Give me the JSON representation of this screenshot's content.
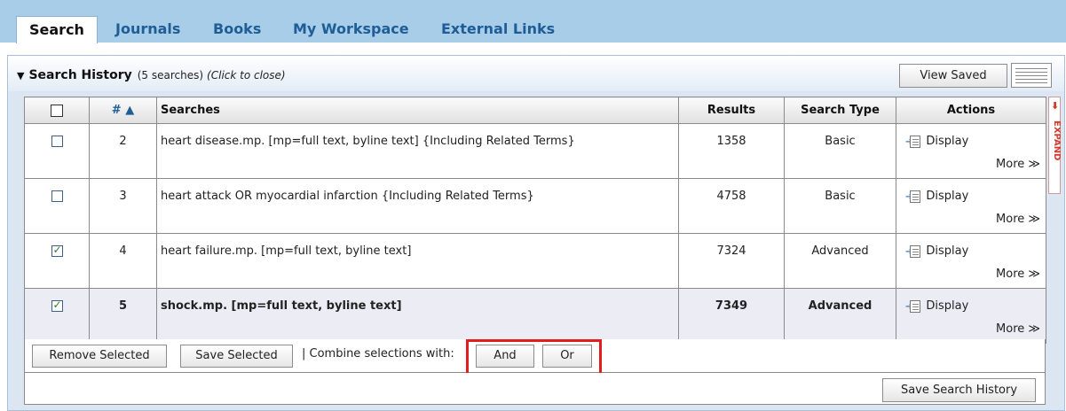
{
  "tabs": [
    {
      "label": "Search",
      "active": true
    },
    {
      "label": "Journals"
    },
    {
      "label": "Books"
    },
    {
      "label": "My Workspace"
    },
    {
      "label": "External Links"
    }
  ],
  "history": {
    "title": "Search History",
    "count": "(5 searches)",
    "close_hint": "(Click to close)",
    "view_saved_label": "View Saved"
  },
  "table": {
    "columns": {
      "number": "# ▲",
      "searches": "Searches",
      "results": "Results",
      "search_type": "Search Type",
      "actions": "Actions"
    },
    "rows": [
      {
        "num": "2",
        "query": "heart disease.mp. [mp=full text, byline text] {Including Related Terms}",
        "results": "1358",
        "type": "Basic",
        "checked": false
      },
      {
        "num": "3",
        "query": "heart attack OR myocardial infarction {Including Related Terms}",
        "results": "4758",
        "type": "Basic",
        "checked": false
      },
      {
        "num": "4",
        "query": "heart failure.mp. [mp=full text, byline text]",
        "results": "7324",
        "type": "Advanced",
        "checked": true
      },
      {
        "num": "5",
        "query": "shock.mp. [mp=full text, byline text]",
        "results": "7349",
        "type": "Advanced",
        "checked": true
      }
    ],
    "display_label": "Display",
    "more_label": "More ≫"
  },
  "expand_label": "EXPAND",
  "actions": {
    "remove_selected": "Remove Selected",
    "save_selected": "Save Selected",
    "combine_label": "| Combine selections with:",
    "and_label": "And",
    "or_label": "Or",
    "save_history": "Save Search History"
  },
  "colors": {
    "accent": "#1e5d96",
    "highlight": "#e01e1e",
    "tabbar": "#a8cde9"
  }
}
